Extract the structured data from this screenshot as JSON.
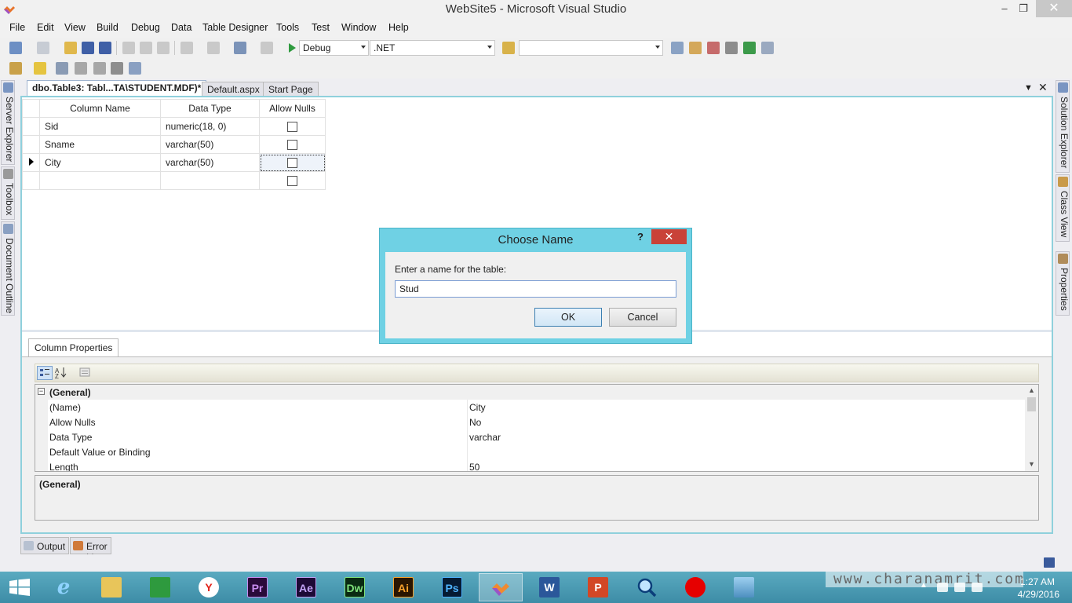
{
  "window": {
    "title": "WebSite5 - Microsoft Visual Studio",
    "minimize": "‒",
    "restore": "❐",
    "close": "✕"
  },
  "menu": [
    "File",
    "Edit",
    "View",
    "Build",
    "Debug",
    "Data",
    "Table Designer",
    "Tools",
    "Test",
    "Window",
    "Help"
  ],
  "toolbar": {
    "config_value": "Debug",
    "platform_value": ".NET",
    "find_value": ""
  },
  "doc_tabs": [
    {
      "label": "dbo.Table3: Tabl...TA\\STUDENT.MDF)*",
      "active": true
    },
    {
      "label": "Default.aspx",
      "active": false
    },
    {
      "label": "Start Page",
      "active": false
    }
  ],
  "left_panels": [
    "Server Explorer",
    "Toolbox",
    "Document Outline"
  ],
  "right_panels": [
    "Solution Explorer",
    "Class View",
    "Properties"
  ],
  "grid": {
    "headers": {
      "name": "Column Name",
      "type": "Data Type",
      "nulls": "Allow Nulls"
    },
    "rows": [
      {
        "name": "Sid",
        "type": "numeric(18, 0)",
        "allow_nulls": false
      },
      {
        "name": "Sname",
        "type": "varchar(50)",
        "allow_nulls": false
      },
      {
        "name": "City",
        "type": "varchar(50)",
        "allow_nulls": false,
        "current": true
      },
      {
        "name": "",
        "type": "",
        "allow_nulls": false
      }
    ]
  },
  "column_properties": {
    "tab_label": "Column Properties",
    "category": "(General)",
    "rows": [
      {
        "key": "(Name)",
        "value": "City"
      },
      {
        "key": "Allow Nulls",
        "value": "No"
      },
      {
        "key": "Data Type",
        "value": "varchar"
      },
      {
        "key": "Default Value or Binding",
        "value": ""
      },
      {
        "key": "Length",
        "value": "50"
      }
    ],
    "description_title": "(General)"
  },
  "bottom_tabs": [
    "Output",
    "Error List"
  ],
  "dialog": {
    "title": "Choose Name",
    "help": "?",
    "close": "✕",
    "prompt": "Enter a name for the table:",
    "input_value": "Stud",
    "ok_label": "OK",
    "cancel_label": "Cancel"
  },
  "taskbar": {
    "apps": [
      {
        "name": "start",
        "label": ""
      },
      {
        "name": "internet-explorer",
        "label": "e"
      },
      {
        "name": "file-explorer",
        "label": ""
      },
      {
        "name": "store",
        "label": ""
      },
      {
        "name": "yandex",
        "label": "Y"
      },
      {
        "name": "premiere",
        "label": "Pr"
      },
      {
        "name": "after-effects",
        "label": "Ae"
      },
      {
        "name": "dreamweaver",
        "label": "Dw"
      },
      {
        "name": "illustrator",
        "label": "Ai"
      },
      {
        "name": "photoshop",
        "label": "Ps"
      },
      {
        "name": "visual-studio",
        "label": ""
      },
      {
        "name": "word",
        "label": "W"
      },
      {
        "name": "powerpoint",
        "label": "P"
      },
      {
        "name": "search",
        "label": ""
      },
      {
        "name": "vodafone",
        "label": ""
      },
      {
        "name": "photos",
        "label": ""
      }
    ],
    "watermark": "www.charanamrit.com",
    "time": "1:27 AM",
    "date": "4/29/2016"
  },
  "colors": {
    "accent": "#8fd0dc",
    "dialog_frame": "#6fd1e4",
    "dialog_close": "#c94238",
    "taskbar": "#4a9bb3"
  }
}
